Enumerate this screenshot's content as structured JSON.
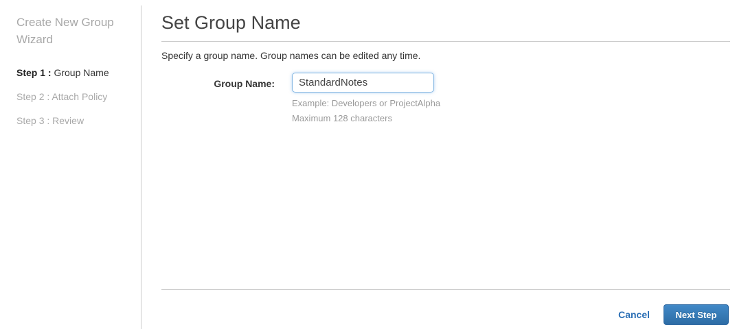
{
  "sidebar": {
    "title": "Create New Group Wizard",
    "steps": [
      {
        "prefix": "Step 1 : ",
        "label": "Group Name"
      },
      {
        "prefix": "Step 2 : ",
        "label": "Attach Policy"
      },
      {
        "prefix": "Step 3 : ",
        "label": "Review"
      }
    ]
  },
  "main": {
    "title": "Set Group Name",
    "description": "Specify a group name. Group names can be edited any time.",
    "form": {
      "label": "Group Name:",
      "value": "StandardNotes",
      "hint_example": "Example: Developers or ProjectAlpha",
      "hint_max": "Maximum 128 characters"
    },
    "footer": {
      "cancel_label": "Cancel",
      "next_label": "Next Step"
    }
  },
  "colors": {
    "link_blue": "#2b6fb5",
    "button_blue_top": "#4189c7",
    "button_blue_bottom": "#2d6ca5",
    "input_focus_border": "#85b7e2",
    "muted_gray": "#a8a8a8",
    "divider_gray": "#cccccc"
  }
}
